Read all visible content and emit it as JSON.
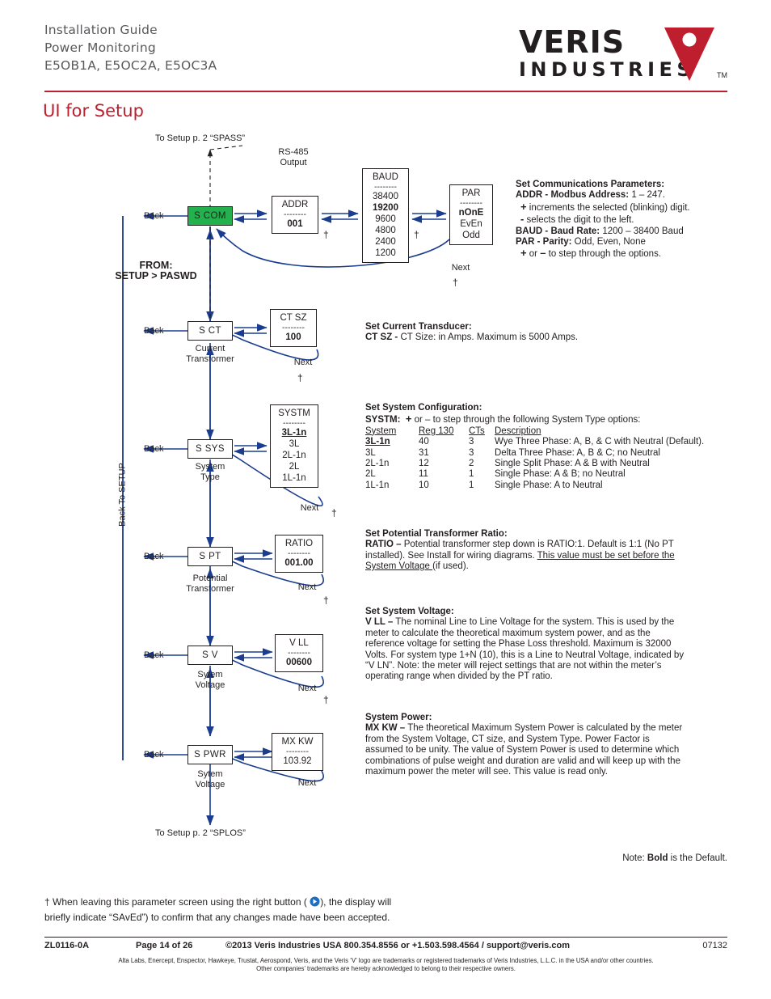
{
  "header": {
    "line1": "Installation Guide",
    "line2": "Power Monitoring",
    "line3": "E5OB1A, E5OC2A, E5OC3A",
    "logo_main": "VERIS",
    "logo_sub": "INDUSTRIES",
    "logo_tm": "TM",
    "accent_color": "#be1e2d"
  },
  "page_title": "UI for Setup",
  "diagram": {
    "top_link": "To Setup p. 2 “SPASS”",
    "rs485_label": "RS-485\nOutput",
    "from_label_1": "FROM:",
    "from_label_2": "SETUP > PASWD",
    "back_to_setup": "Back To SETUP",
    "bottom_link": "To Setup p. 2 “SPLOS”",
    "back_labels": [
      "Back",
      "Back",
      "Back",
      "Back",
      "Back",
      "Back"
    ],
    "next_labels": [
      "Next",
      "Next",
      "Next",
      "Next",
      "Next",
      "Next"
    ],
    "dagger": "†",
    "nodes": {
      "s_com": "S COM",
      "s_ct": "S  CT",
      "s_sys": "S  SYS",
      "s_pt": "S  PT",
      "s_v": "S    V",
      "s_pwr": "S  PWR"
    },
    "node_labels": {
      "ct": "Current\nTransformer",
      "sys": "System\nType",
      "pt": "Potential\nTransformer",
      "v": "Sytem\nVoltage",
      "pwr": "Sytem\nVoltage"
    },
    "values": {
      "addr": {
        "title": "ADDR",
        "value": "001"
      },
      "baud": {
        "title": "BAUD",
        "options": [
          "38400",
          "19200",
          "9600",
          "4800",
          "2400",
          "1200"
        ],
        "default": "19200"
      },
      "par": {
        "title": "PAR",
        "options": [
          "nOnE",
          "EvEn",
          "Odd"
        ],
        "default": "nOnE"
      },
      "ct_sz": {
        "title": "CT SZ",
        "value": "100"
      },
      "systm": {
        "title": "SYSTM",
        "options": [
          "3L-1n",
          "3L",
          "2L-1n",
          "2L",
          "1L-1n"
        ],
        "default": "3L-1n"
      },
      "ratio": {
        "title": "RATIO",
        "value": "001.00"
      },
      "v_ll": {
        "title": "V LL",
        "value": "00600"
      },
      "mx_kw": {
        "title": "MX  KW",
        "value": "103.92"
      }
    }
  },
  "text_blocks": {
    "comms": {
      "heading": "Set Communications Parameters:",
      "lines": [
        "ADDR - Modbus Address: 1 – 247.",
        "  + increments the selected (blinking) digit.",
        "  - selects the digit to the left.",
        "BAUD - Baud Rate: 1200 – 38400 Baud",
        "PAR - Parity: Odd, Even, None",
        "  + or – to step through the options."
      ]
    },
    "ct": {
      "heading": "Set Current Transducer:",
      "lines": [
        "CT SZ - CT Size: in Amps. Maximum is 5000 Amps."
      ]
    },
    "sys": {
      "heading": "Set System Configuration:",
      "intro": "SYSTM:   + or – to step through the following System Type options:",
      "columns": [
        "System",
        "Reg 130",
        "CTs",
        "Description"
      ],
      "rows": [
        {
          "system": "3L-1n",
          "reg": "40",
          "cts": "3",
          "desc": "Wye Three Phase: A,  B, & C with Neutral (Default)."
        },
        {
          "system": "3L",
          "reg": "31",
          "cts": "3",
          "desc": "Delta Three Phase: A, B & C; no Neutral"
        },
        {
          "system": "2L-1n",
          "reg": "12",
          "cts": "2",
          "desc": "Single Split Phase: A & B with Neutral"
        },
        {
          "system": "2L",
          "reg": "11",
          "cts": "1",
          "desc": "Single Phase: A & B; no Neutral"
        },
        {
          "system": "1L-1n",
          "reg": "10",
          "cts": "1",
          "desc": "Single Phase: A to Neutral"
        }
      ]
    },
    "pt": {
      "heading": "Set Potential Transformer Ratio:",
      "body_1": "RATIO – ",
      "body_2": "Potential transformer step down is RATIO:1. Default is 1:1 (No PT installed). See Install for wiring diagrams. ",
      "body_underline": "This value must be set before the System Voltage ",
      "body_3": "(if used)."
    },
    "voltage": {
      "heading": "Set System Voltage:",
      "body": "V LL – The nominal Line to Line Voltage for the system. This is used by the meter to calculate the theoretical maximum system power, and as the reference voltage for setting the Phase Loss threshold. Maximum is 32000 Volts. For system type 1+N (10), this is a Line to Neutral Voltage, indicated by “V LN”. Note: the meter will reject settings that are not within the meter’s operating range when divided by the PT ratio."
    },
    "power": {
      "heading": "System Power:",
      "body": "MX KW – The theoretical Maximum System Power is calculated by the meter from the System Voltage, CT size, and System Type. Power Factor is assumed to be unity. The value of System Power is used to determine which combinations of pulse weight and duration are valid and will keep up with the maximum power the meter will see. This value is read only."
    },
    "note_default_pre": "Note: ",
    "note_default_bold": "Bold",
    "note_default_post": " is the Default."
  },
  "footnote": {
    "line1_a": "† When leaving this parameter screen using the right button ( ",
    "line1_b": "), the display will",
    "line2": "briefly indicate “SAvEd”) to confirm that any changes made have been accepted."
  },
  "footer": {
    "doc_id": "ZL0116-0A",
    "page": "Page 14 of 26",
    "copyright": "©2013 Veris Industries   USA 800.354.8556 or +1.503.598.4564 / support@veris.com",
    "date_code": "07132",
    "legal_line1": "Alta Labs, Enercept, Enspector, Hawkeye, Trustat, Aerospond, Veris, and the Veris ‘V’ logo are trademarks or registered trademarks of Veris Industries, L.L.C. in the USA and/or other countries.",
    "legal_line2": "Other companies’ trademarks are hereby acknowledged to belong to their respective owners."
  }
}
